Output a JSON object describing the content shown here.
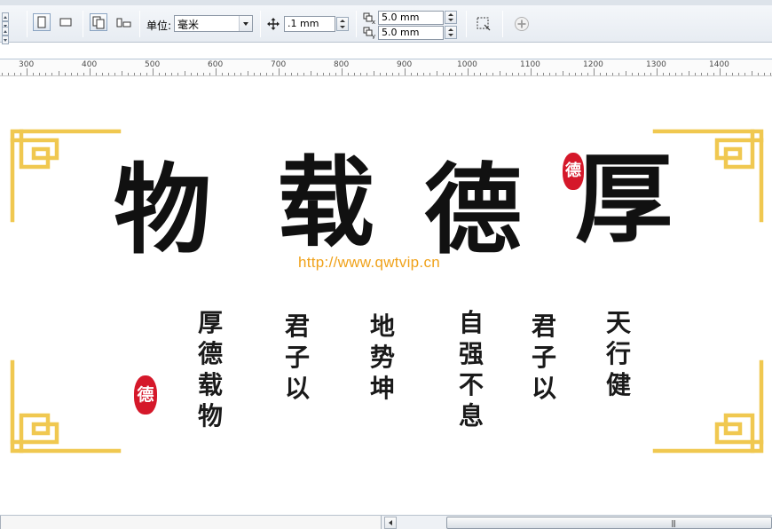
{
  "toolbar": {
    "unit_label": "单位:",
    "unit_value": "毫米",
    "nudge_value": ".1 mm",
    "dup_x_value": "5.0 mm",
    "dup_y_value": "5.0 mm"
  },
  "ruler": {
    "labels": [
      "300",
      "400",
      "500",
      "600",
      "700",
      "800",
      "900",
      "1000",
      "1100",
      "1200",
      "1300",
      "1400"
    ]
  },
  "artwork": {
    "title_chars": [
      "物",
      "载",
      "德",
      "厚"
    ],
    "seal_text": "德",
    "watermark": "http://www.qwtvip.cn",
    "columns": [
      {
        "text": "厚德载物"
      },
      {
        "text": "君子以"
      },
      {
        "text": "地势坤"
      },
      {
        "text": "自强不息"
      },
      {
        "text": "君子以"
      },
      {
        "text": "天行健"
      }
    ],
    "colors": {
      "frame_gold": "#f0c850",
      "seal_red": "#d5182a",
      "ink": "#111111",
      "watermark": "#f0a21a"
    }
  },
  "icons": {
    "nudge": "move-cross-icon",
    "duplicate": "duplicate-offset-icon",
    "add": "plus-circle-icon"
  }
}
